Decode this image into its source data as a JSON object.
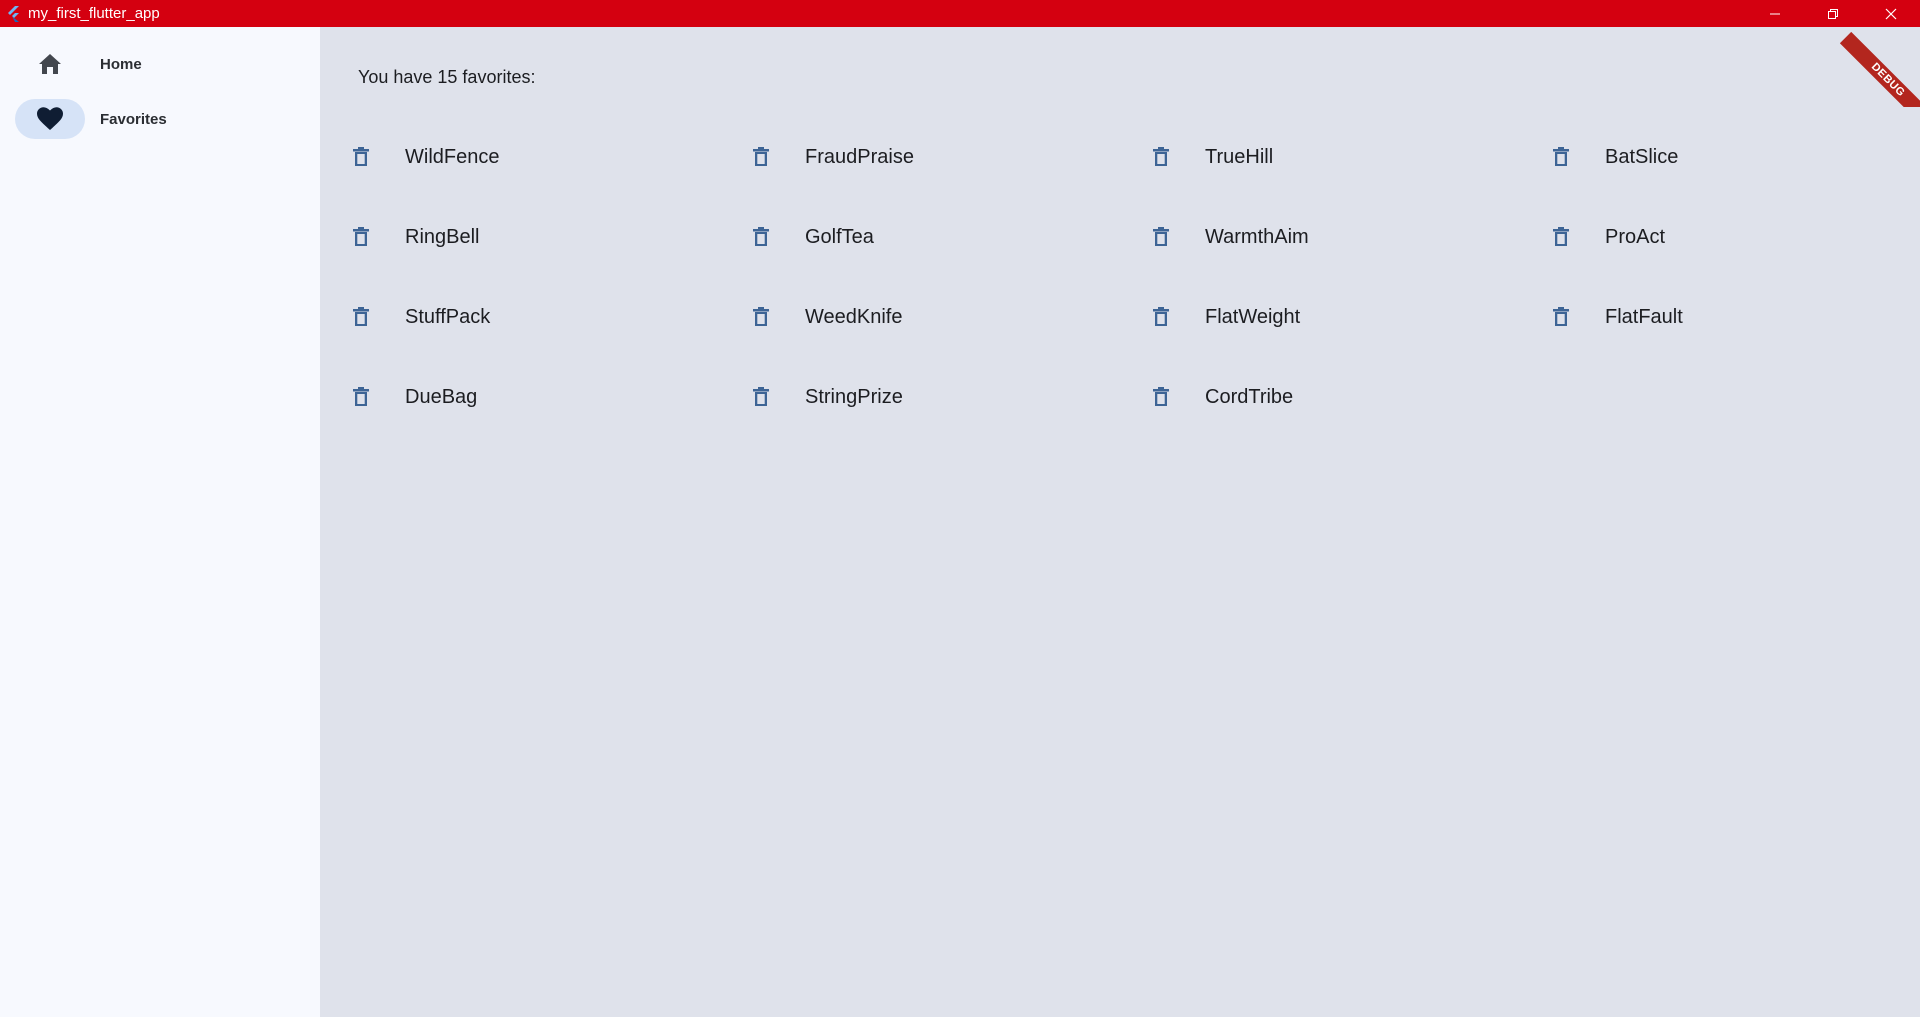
{
  "window": {
    "title": "my_first_flutter_app",
    "app_icon": "flutter-icon",
    "minimize_icon": "minimize-icon",
    "restore_icon": "restore-icon",
    "close_icon": "close-icon",
    "titlebar_color": "#d40010"
  },
  "sidebar": {
    "items": [
      {
        "label": "Home",
        "icon": "home-icon",
        "selected": false
      },
      {
        "label": "Favorites",
        "icon": "heart-icon",
        "selected": true
      }
    ]
  },
  "favorites": {
    "heading": "You have 15 favorites:",
    "delete_icon": "trash-icon",
    "items": [
      "WildFence",
      "FraudPraise",
      "TrueHill",
      "BatSlice",
      "RingBell",
      "GolfTea",
      "WarmthAim",
      "ProAct",
      "StuffPack",
      "WeedKnife",
      "FlatWeight",
      "FlatFault",
      "DueBag",
      "StringPrize",
      "CordTribe"
    ]
  },
  "debug_banner": "DEBUG",
  "colors": {
    "accent": "#3d6495",
    "selected_indicator": "#d6e3f7",
    "main_bg": "#dfe2eb",
    "sidebar_bg": "#f7f9fe"
  }
}
